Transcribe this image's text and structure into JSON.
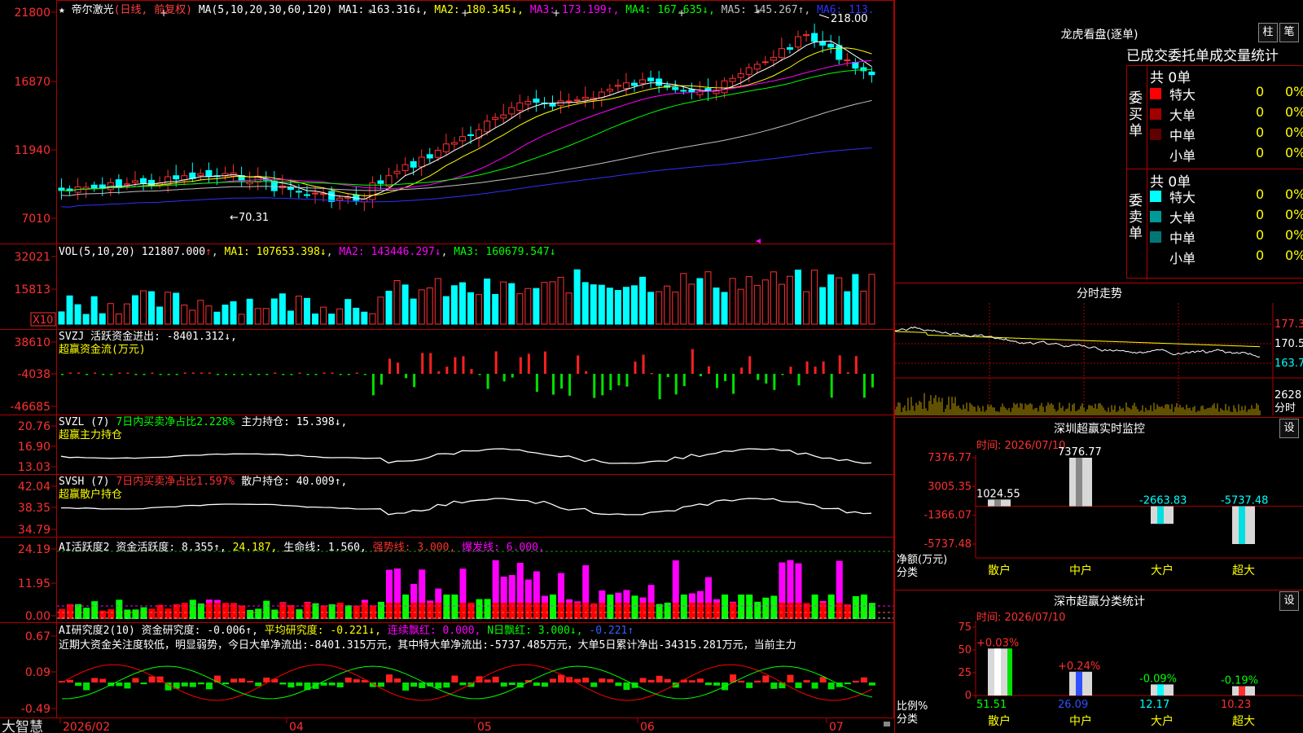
{
  "stock": {
    "name": "帝尔激光",
    "period_note": "(日线, 前复权)",
    "ma_param": "MA(5,10,20,30,60,120)",
    "ma": [
      {
        "label": "MA1:",
        "value": "163.316",
        "arrow": "↓",
        "color": "#ffffff"
      },
      {
        "label": "MA2:",
        "value": "180.345",
        "arrow": "↓",
        "color": "#ffff00"
      },
      {
        "label": "MA3:",
        "value": "173.199",
        "arrow": "↑",
        "color": "#ff00ff"
      },
      {
        "label": "MA4:",
        "value": "167.635",
        "arrow": "↓",
        "color": "#00ff00"
      },
      {
        "label": "MA5:",
        "value": "145.267",
        "arrow": "↑",
        "color": "#c0c0c0"
      },
      {
        "label": "MA6:",
        "value": "113.",
        "arrow": "",
        "color": "#3030ff"
      }
    ],
    "high_label": "218.00",
    "low_label": "←70.31"
  },
  "price_axis": [
    "21800",
    "16870",
    "11940",
    "7010"
  ],
  "vol": {
    "label": "VOL(5,10,20)",
    "value": "121807.000",
    "arrow": "↑",
    "ma1": "MA1: 107653.398↓",
    "ma2": "MA2: 143446.297↓",
    "ma3": "MA3: 160679.547↓",
    "axis": [
      "32021",
      "15813"
    ],
    "unit": "X10"
  },
  "svzj": {
    "label": "SVZJ",
    "text": "活跃资金进出: -8401.312↓,",
    "sub": "超赢资金流(万元)",
    "axis": [
      "38610",
      "-4038",
      "-46685"
    ]
  },
  "svzl": {
    "label": "SVZL (7)",
    "text1": "7日内买卖净占比2.228%",
    "text2": "主力持仓: 15.398↓,",
    "sub": "超赢主力持仓",
    "axis": [
      "20.76",
      "16.90",
      "13.03"
    ]
  },
  "svsh": {
    "label": "SVSH (7)",
    "text1": "7日内买卖净占比1.597%",
    "text2": "散户持仓: 40.009↑,",
    "sub": "超赢散户持仓",
    "axis": [
      "42.04",
      "38.35",
      "34.79"
    ]
  },
  "ai1": {
    "label": "AI活跃度2",
    "t1": "资金活跃度: 8.355↑,",
    "t2": "24.187,",
    "t3": "生命线: 1.560,",
    "t4": "强势线: 3.000,",
    "t5": "爆发线: 6.000,",
    "axis": [
      "24.19",
      "11.95",
      "0.00"
    ]
  },
  "ai2": {
    "label": "AI研究度2(10)",
    "t1": "资金研究度: -0.006↑,",
    "t2": "平均研究度: -0.221↓,",
    "t3": "连续飘红: 0.000,",
    "t4": "N日飘红: 3.000↓,",
    "t5": "-0.221↑",
    "comment": "近期大资金关注度较低，明显弱势，今日大单净流出:-8401.315万元，其中特大单净流出:-5737.485万元，大单5日累计净出-34315.281万元，当前主力",
    "axis": [
      "0.67",
      "0.09",
      "-0.49"
    ]
  },
  "date_axis": [
    "2026/02",
    "04",
    "05",
    "06",
    "07"
  ],
  "brand": "大智慧",
  "lhb": {
    "title": "龙虎看盘(逐单)",
    "btn1": "柱",
    "btn2": "笔",
    "tabs": [
      "已成交",
      "委托单",
      "成交量统计"
    ],
    "buy_title": "委买单",
    "sell_title": "委卖单",
    "buy_total": "共 0单",
    "sell_total": "共 0单",
    "buy_rows": [
      {
        "name": "特大",
        "count": "0",
        "pct": "0%",
        "color": "#ff0000"
      },
      {
        "name": "大单",
        "count": "0",
        "pct": "0%",
        "color": "#a00000"
      },
      {
        "name": "中单",
        "count": "0",
        "pct": "0%",
        "color": "#600000"
      },
      {
        "name": "小单",
        "count": "0",
        "pct": "0%",
        "color": ""
      }
    ],
    "sell_rows": [
      {
        "name": "特大",
        "count": "0",
        "pct": "0%",
        "color": "#00ffff"
      },
      {
        "name": "大单",
        "count": "0",
        "pct": "0%",
        "color": "#009999"
      },
      {
        "name": "中单",
        "count": "0",
        "pct": "0%",
        "color": "#007777"
      },
      {
        "name": "小单",
        "count": "0",
        "pct": "0%",
        "color": ""
      }
    ]
  },
  "fenshi": {
    "title": "分时走势",
    "axis": [
      "177.3",
      "170.5",
      "163.7"
    ],
    "vol_label": "2628",
    "vol_unit": "分时"
  },
  "monitor": {
    "title": "深圳超赢实时监控",
    "btn": "设",
    "time": "时间: 2026/07/10",
    "yaxis": [
      "7376.77",
      "3005.35",
      "-1366.07",
      "-5737.48"
    ],
    "ylabel1": "净额(万元)",
    "ylabel2": "分类",
    "categories": [
      "散户",
      "中户",
      "大户",
      "超大"
    ],
    "values": [
      1024.55,
      7376.77,
      -2663.83,
      -5737.48
    ],
    "value_labels": [
      "1024.55",
      "7376.77",
      "-2663.83",
      "-5737.48"
    ]
  },
  "classify": {
    "title": "深市超赢分类统计",
    "btn": "设",
    "time": "时间: 2026/07/10",
    "yaxis": [
      "75",
      "50",
      "25",
      "0"
    ],
    "ylabel1": "比例%",
    "ylabel2": "分类",
    "categories": [
      "散户",
      "中户",
      "大户",
      "超大"
    ],
    "values": [
      51.51,
      26.09,
      12.17,
      10.23
    ],
    "value_labels": [
      "51.51",
      "26.09",
      "12.17",
      "10.23"
    ],
    "changes": [
      "+0.03%",
      "+0.24%",
      "-0.09%",
      "-0.19%"
    ]
  },
  "chart_data": [
    {
      "type": "bar",
      "title": "深圳超赢实时监控",
      "ylabel": "净额(万元)",
      "xlabel": "分类",
      "categories": [
        "散户",
        "中户",
        "大户",
        "超大"
      ],
      "values": [
        1024.55,
        7376.77,
        -2663.83,
        -5737.48
      ],
      "ylim": [
        -5737.48,
        7376.77
      ]
    },
    {
      "type": "bar",
      "title": "深市超赢分类统计",
      "ylabel": "比例%",
      "xlabel": "分类",
      "categories": [
        "散户",
        "中户",
        "大户",
        "超大"
      ],
      "values": [
        51.51,
        26.09,
        12.17,
        10.23
      ],
      "ylim": [
        0,
        75
      ]
    }
  ]
}
